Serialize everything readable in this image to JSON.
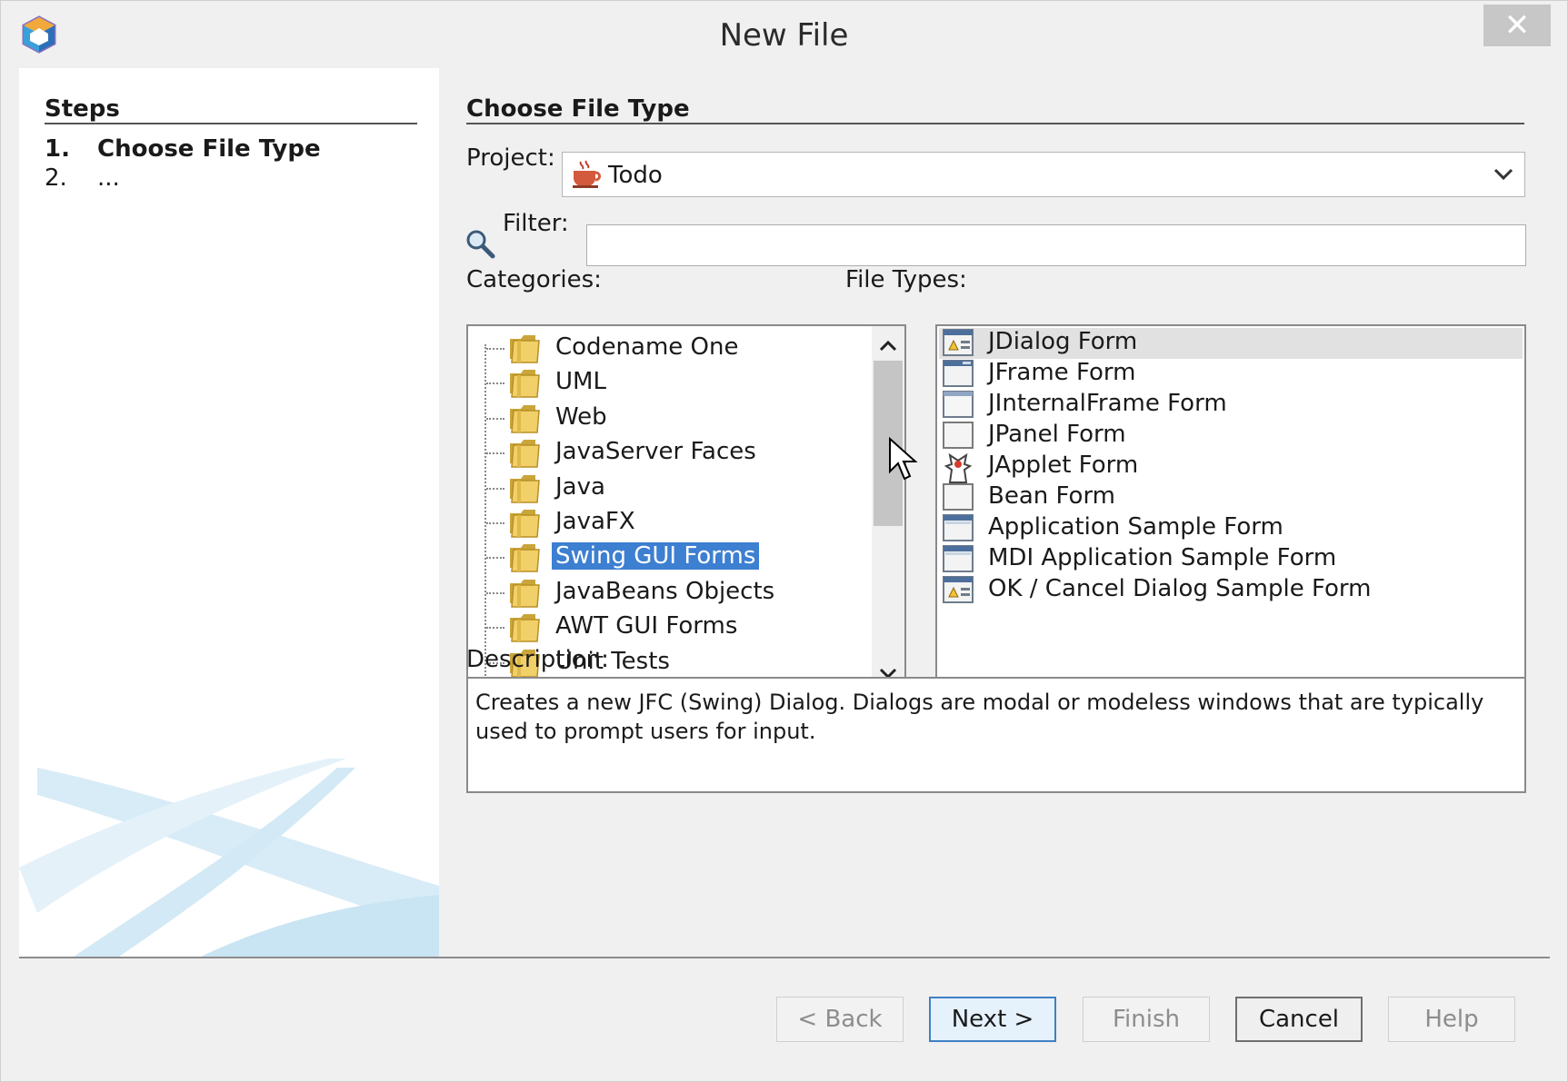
{
  "window": {
    "title": "New File",
    "close_glyph": "✕"
  },
  "steps": {
    "title": "Steps",
    "items": [
      {
        "num": "1.",
        "label": "Choose File Type",
        "current": true
      },
      {
        "num": "2.",
        "label": "...",
        "current": false
      }
    ]
  },
  "main": {
    "section_title": "Choose File Type",
    "project_label": "Project:",
    "project_value": "Todo",
    "filter_label": "Filter:",
    "filter_value": "",
    "categories_label": "Categories:",
    "categories": [
      "Codename One",
      "UML",
      "Web",
      "JavaServer Faces",
      "Java",
      "JavaFX",
      "Swing GUI Forms",
      "JavaBeans Objects",
      "AWT GUI Forms",
      "Unit Tests"
    ],
    "selected_category": "Swing GUI Forms",
    "file_types_label": "File Types:",
    "file_types": [
      {
        "label": "JDialog Form",
        "icon": "dialog-form-icon"
      },
      {
        "label": "JFrame Form",
        "icon": "frame-form-icon"
      },
      {
        "label": "JInternalFrame Form",
        "icon": "internal-frame-icon"
      },
      {
        "label": "JPanel Form",
        "icon": "panel-form-icon"
      },
      {
        "label": "JApplet Form",
        "icon": "applet-form-icon"
      },
      {
        "label": "Bean Form",
        "icon": "bean-form-icon"
      },
      {
        "label": "Application Sample Form",
        "icon": "application-form-icon"
      },
      {
        "label": "MDI Application Sample Form",
        "icon": "mdi-form-icon"
      },
      {
        "label": "OK / Cancel Dialog Sample Form",
        "icon": "ok-cancel-dialog-icon"
      }
    ],
    "selected_file_type": "JDialog Form",
    "description_label": "Description:",
    "description": "Creates a new JFC (Swing) Dialog. Dialogs are modal or modeless windows that are typically used to prompt users for input."
  },
  "buttons": {
    "back": "< Back",
    "next": "Next >",
    "finish": "Finish",
    "cancel": "Cancel",
    "help": "Help"
  },
  "colors": {
    "selection": "#3d7fd1",
    "default_button_border": "#3f80c4",
    "folder": "#e8c34a"
  }
}
